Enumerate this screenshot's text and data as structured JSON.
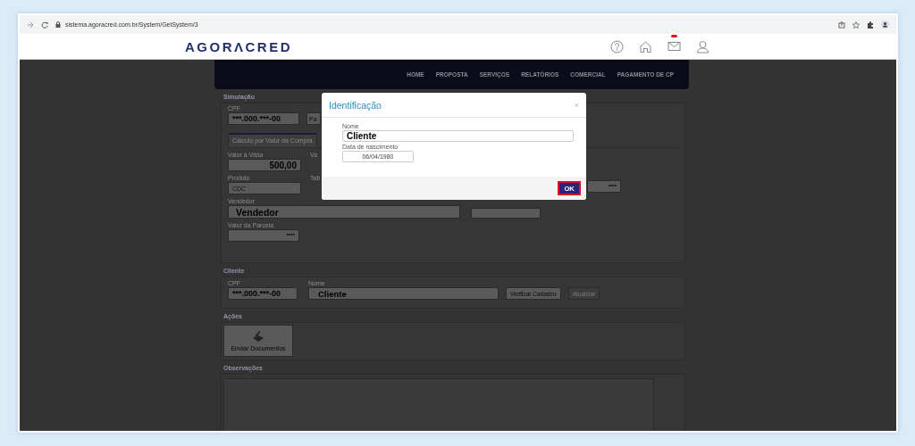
{
  "browser": {
    "url": "sistema.agoracred.com.br/System/GetSystem/3"
  },
  "header": {
    "logo": "AGORΛCRED",
    "mail_unread": true
  },
  "nav": {
    "items": [
      "HOME",
      "PROPOSTA",
      "SERVIÇOS",
      "RELATÓRIOS",
      "COMERCIAL",
      "PAGAMENTO DE CP"
    ]
  },
  "simulacao": {
    "title": "Simulação",
    "cpf_label": "CPF",
    "cpf_value": "***.000.***-00",
    "cut_button": "Pa",
    "tabs": [
      {
        "label": "Cálculo por Valor da Compra",
        "selected": true
      }
    ],
    "valor_vista": {
      "label": "Valor à Vista",
      "value": "500,00"
    },
    "cut_label_1": "Va",
    "produto": {
      "label": "Produto",
      "value": "CDC"
    },
    "cut_label_2": "Tab",
    "right_field": "****",
    "vendedor": {
      "label": "Vendedor",
      "value": "Vendedor"
    },
    "parcela": {
      "label": "Valor da Parcela",
      "value": "****"
    }
  },
  "cliente": {
    "title": "Cliente",
    "cpf_label": "CPF",
    "cpf_value": "***.000.***-00",
    "nome_label": "Nome",
    "nome_value": "Cliente",
    "buttons": [
      {
        "label": "Verificar Cadastro",
        "disabled": false
      },
      {
        "label": "Atualizar",
        "disabled": true
      }
    ]
  },
  "acoes": {
    "title": "Ações",
    "button": "Enviar Documentos"
  },
  "observacoes": {
    "title": "Observações"
  },
  "modal": {
    "title": "Identificação",
    "close": "×",
    "nome_label": "Nome",
    "nome_value": "Cliente",
    "data_label": "Data de nascimento",
    "data_value": "06/04/1980",
    "ok": "OK"
  }
}
